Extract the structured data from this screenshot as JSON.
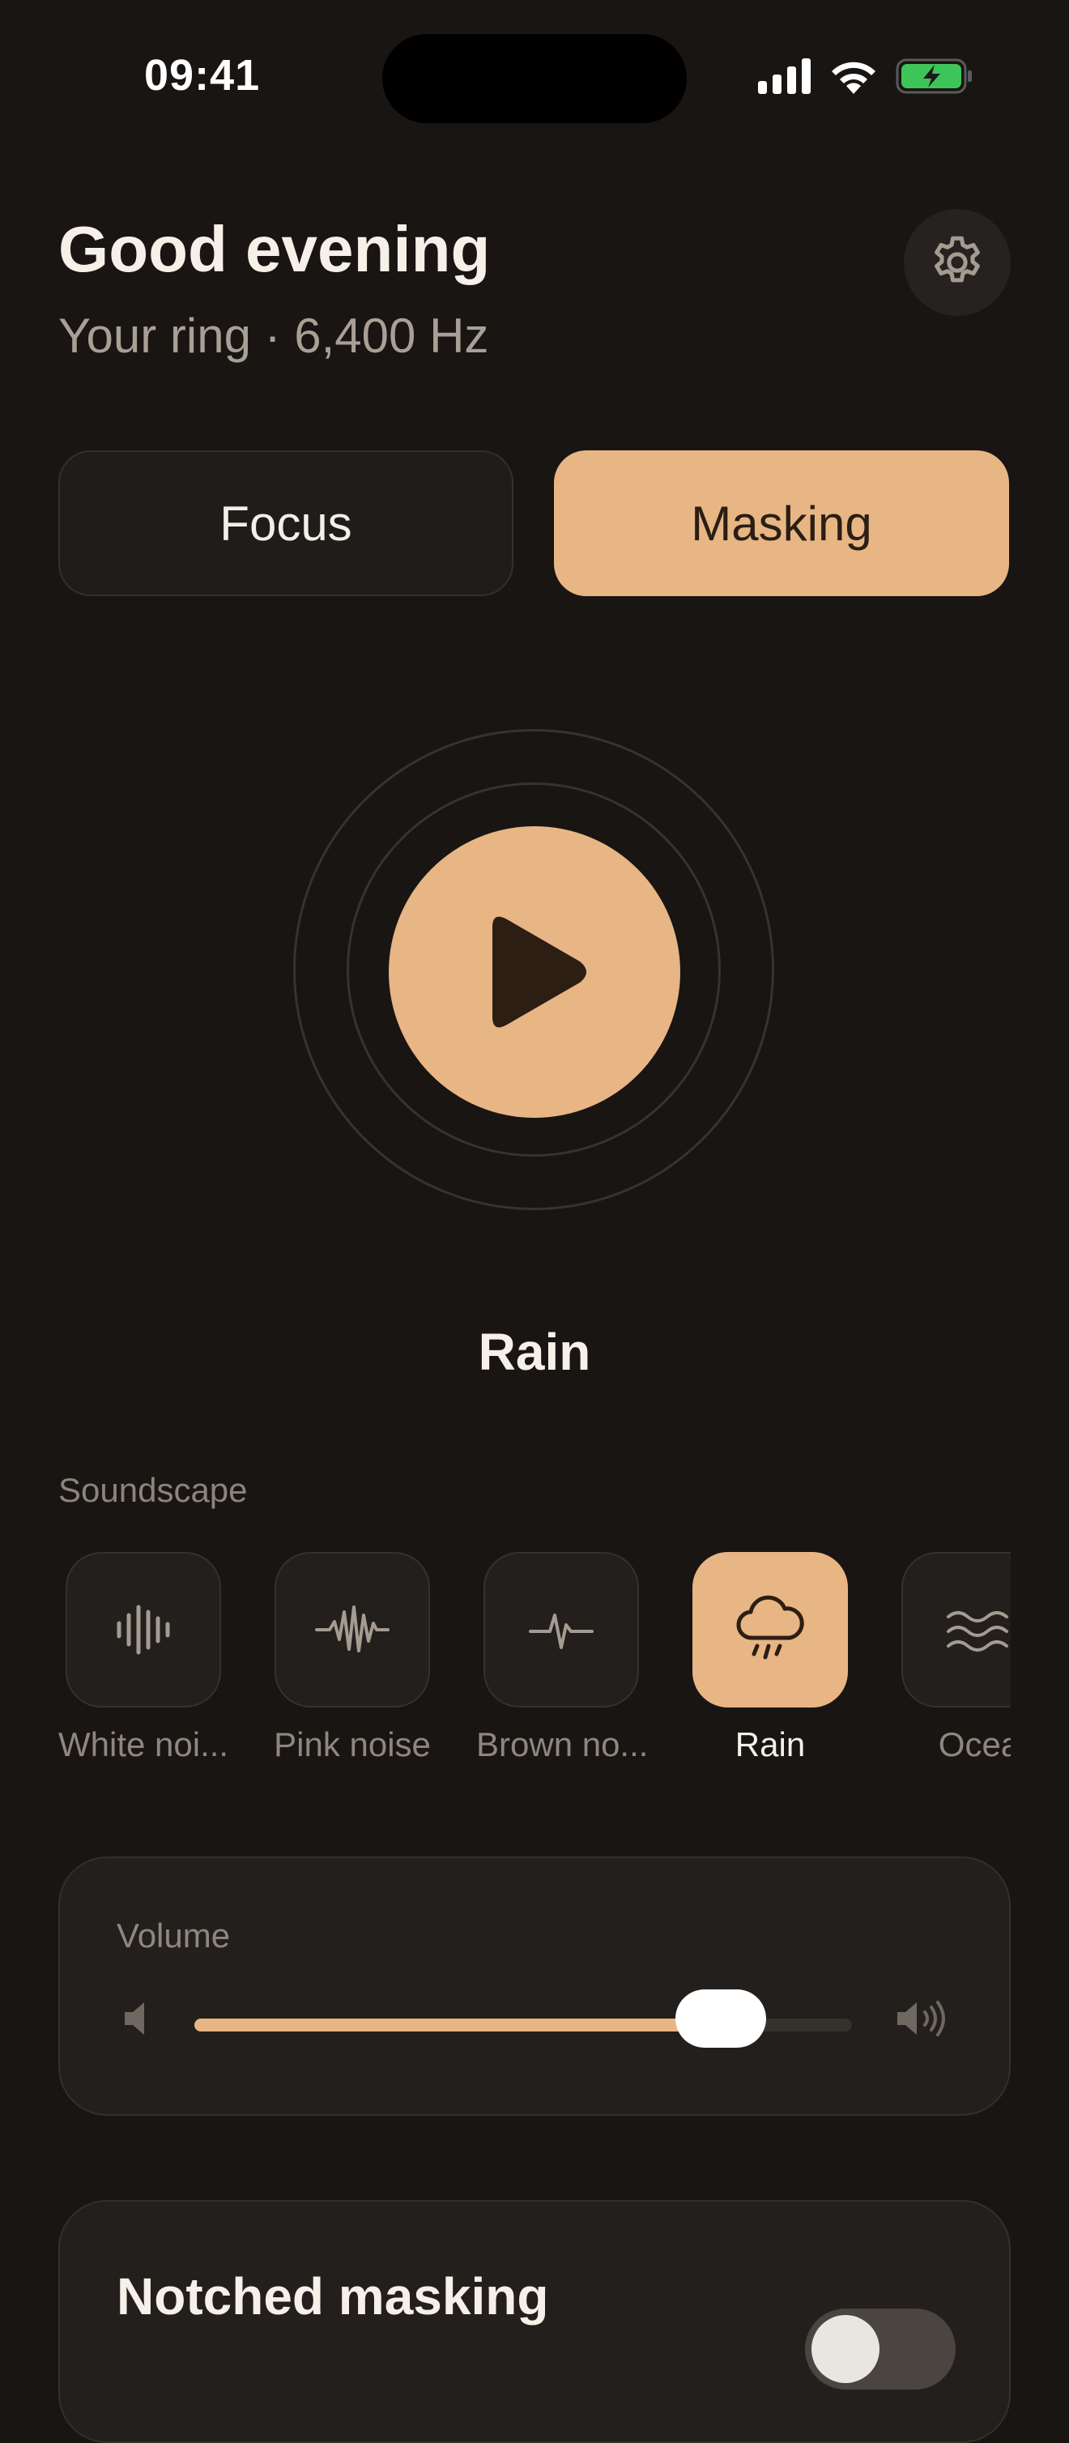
{
  "status_bar": {
    "time": "09:41",
    "icons": [
      "cellular-signal-icon",
      "wifi-icon",
      "battery-charging-icon"
    ],
    "battery_color": "#3ec55a"
  },
  "header": {
    "greeting": "Good evening",
    "subtitle": "Your ring · 6,400 Hz",
    "settings_icon": "gear-icon"
  },
  "mode_tabs": {
    "items": [
      {
        "label": "Focus",
        "selected": false
      },
      {
        "label": "Masking",
        "selected": true
      }
    ]
  },
  "player": {
    "play_icon": "play-icon",
    "now_playing": "Rain"
  },
  "soundscape": {
    "section_label": "Soundscape",
    "items": [
      {
        "label": "White noi...",
        "icon": "white-noise-waveform-icon",
        "selected": false
      },
      {
        "label": "Pink noise",
        "icon": "pink-noise-waveform-icon",
        "selected": false
      },
      {
        "label": "Brown no...",
        "icon": "brown-noise-pulse-icon",
        "selected": false
      },
      {
        "label": "Rain",
        "icon": "rain-cloud-icon",
        "selected": true
      },
      {
        "label": "Ocea",
        "icon": "ocean-waves-icon",
        "selected": false
      }
    ]
  },
  "volume": {
    "label": "Volume",
    "level_percent": 80
  },
  "notched_masking": {
    "title": "Notched masking",
    "enabled": false
  },
  "colors": {
    "background": "#181513",
    "accent": "#e8b584",
    "card": "#221f1c",
    "muted_text": "#8f877e"
  }
}
